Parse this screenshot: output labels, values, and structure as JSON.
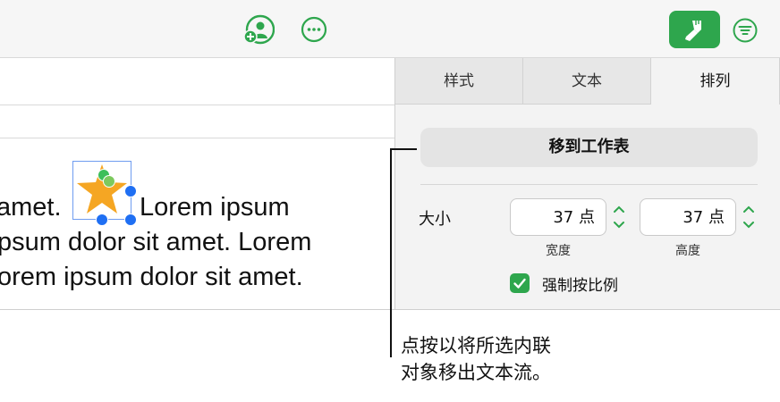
{
  "document": {
    "line1_before": "amet.",
    "line1_after": "Lorem ipsum",
    "line2": "psum dolor sit amet. Lorem",
    "line3": "orem ipsum dolor sit amet."
  },
  "sidebar": {
    "tabs": [
      {
        "label": "样式"
      },
      {
        "label": "文本"
      },
      {
        "label": "排列",
        "selected": true
      }
    ],
    "move_button": "移到工作表",
    "size_label": "大小",
    "width_value": "37 点",
    "height_value": "37 点",
    "width_caption": "宽度",
    "height_caption": "高度",
    "constrain_label": "强制按比例",
    "constrain_checked": true
  },
  "callout": {
    "line1": "点按以将所选内联",
    "line2": "对象移出文本流。"
  },
  "colors": {
    "accent_green": "#2ea64d",
    "selection_blue": "#1f6ff3",
    "star_orange": "#f5a623"
  },
  "icons": [
    "add-collaborator-icon",
    "more-icon",
    "format-paintbrush-icon",
    "organize-icon",
    "star-shape-icon",
    "checkmark-icon"
  ]
}
